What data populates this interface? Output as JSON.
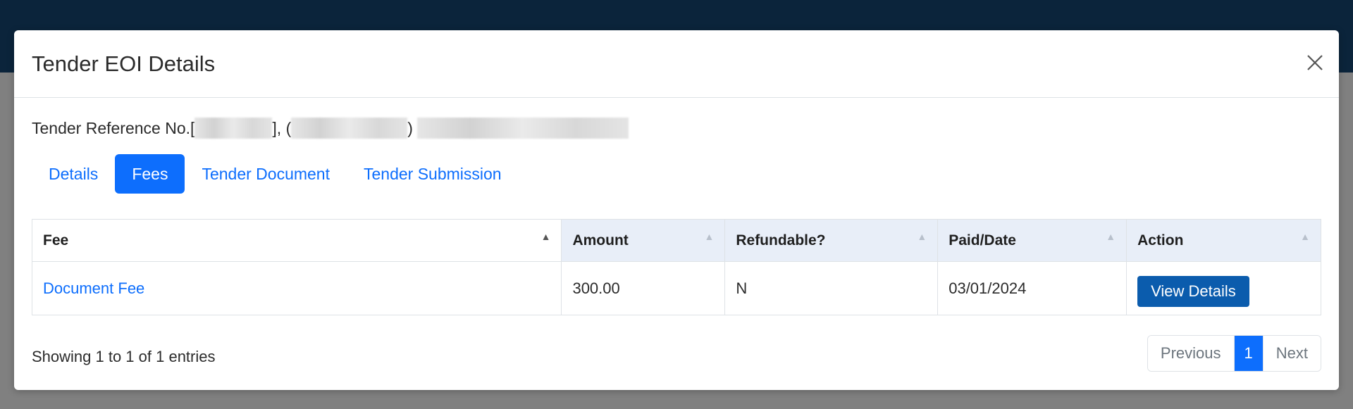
{
  "modal": {
    "title": "Tender EOI Details"
  },
  "reference": {
    "prefix": "Tender Reference No.[",
    "sep1": "], (",
    "sep2": ")"
  },
  "tabs": [
    {
      "label": "Details",
      "active": false
    },
    {
      "label": "Fees",
      "active": true
    },
    {
      "label": "Tender Document",
      "active": false
    },
    {
      "label": "Tender Submission",
      "active": false
    }
  ],
  "table": {
    "columns": [
      "Fee",
      "Amount",
      "Refundable?",
      "Paid/Date",
      "Action"
    ],
    "rows": [
      {
        "fee": "Document Fee",
        "amount": "300.00",
        "refundable": "N",
        "paid_date": "03/01/2024",
        "action": "View Details"
      }
    ]
  },
  "footer": {
    "info": "Showing 1 to 1 of 1 entries",
    "pagination": {
      "previous": "Previous",
      "current": "1",
      "next": "Next"
    }
  },
  "colors": {
    "accent": "#0d6efd",
    "button": "#0b5cad",
    "topbar": "#0b243b"
  },
  "icons": {
    "close": "close-icon",
    "sort": "sort-icon"
  }
}
